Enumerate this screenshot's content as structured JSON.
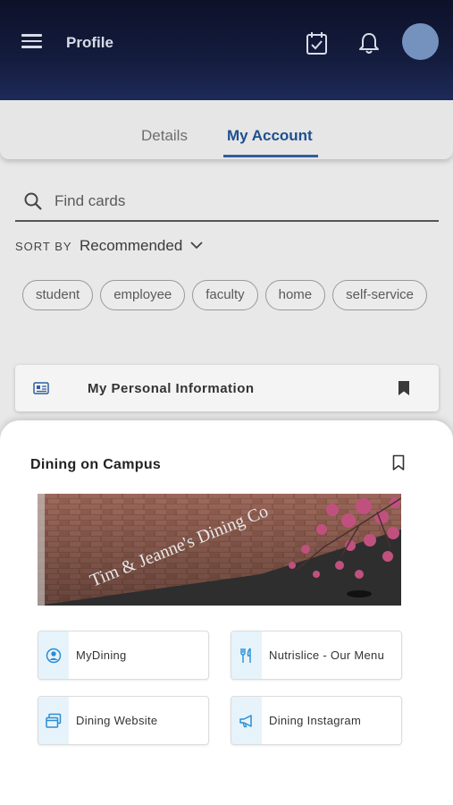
{
  "header": {
    "title": "Profile",
    "icons": [
      "menu-icon",
      "calendar-check-icon",
      "bell-icon",
      "avatar"
    ]
  },
  "tabs": [
    {
      "label": "Details",
      "active": false
    },
    {
      "label": "My Account",
      "active": true
    }
  ],
  "search": {
    "placeholder": "Find cards"
  },
  "sort": {
    "label": "SORT BY",
    "value": "Recommended"
  },
  "chips": [
    "student",
    "employee",
    "faculty",
    "home",
    "self-service"
  ],
  "personal_card": {
    "label": "My Personal Information",
    "icon": "id-card-icon"
  },
  "sheet": {
    "title": "Dining on Campus",
    "banner_sign": "Tim & Jeanne's Dining Co",
    "links": [
      {
        "label": "MyDining",
        "icon": "user-circle-icon"
      },
      {
        "label": "Nutrislice - Our Menu",
        "icon": "fork-knife-icon"
      },
      {
        "label": "Dining Website",
        "icon": "windows-icon"
      },
      {
        "label": "Dining Instagram",
        "icon": "megaphone-icon"
      }
    ]
  },
  "colors": {
    "header_bg": "#141c3e",
    "accent": "#1f4f8f",
    "avatar": "#7592bf",
    "icon_blue": "#2a8ed6",
    "link_icon_bg": "#e7f3fb"
  }
}
